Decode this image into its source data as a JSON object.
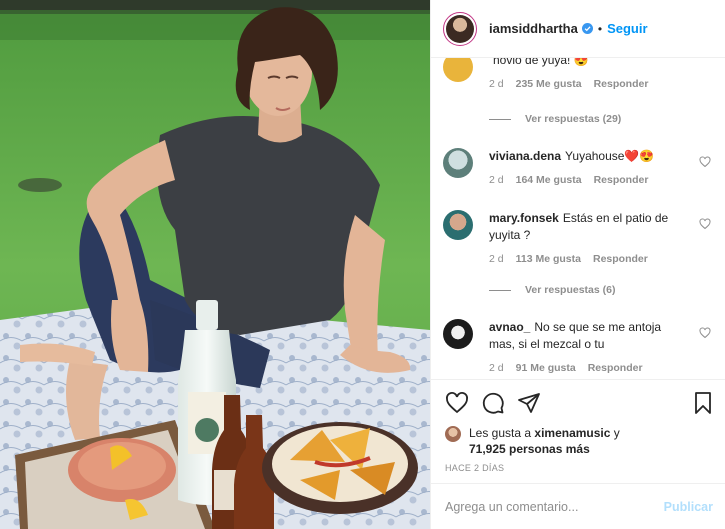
{
  "header": {
    "username": "iamsiddhartha",
    "separator": "•",
    "follow_label": "Seguir",
    "icons": {
      "verified": "verified-badge-icon",
      "avatar": "profile-avatar"
    },
    "colors": {
      "accent": "#0095f6",
      "ring": "#c13584"
    }
  },
  "comments": [
    {
      "username": "",
      "text": "novio de yuya! 😍",
      "time": "2 d",
      "likes": "235 Me gusta",
      "reply": "Responder",
      "view_replies": "Ver respuestas (29)"
    },
    {
      "username": "viviana.dena",
      "text": "Yuyahouse❤️😍",
      "time": "2 d",
      "likes": "164 Me gusta",
      "reply": "Responder",
      "view_replies": ""
    },
    {
      "username": "mary.fonsek",
      "text": "Estás en el patio de yuyita ?",
      "time": "2 d",
      "likes": "113 Me gusta",
      "reply": "Responder",
      "view_replies": "Ver respuestas (6)"
    },
    {
      "username": "avnao_",
      "text": "No se que se me antoja mas, si el mezcal o tu",
      "time": "2 d",
      "likes": "91 Me gusta",
      "reply": "Responder",
      "view_replies": ""
    }
  ],
  "actions": {
    "icons": [
      "heart-icon",
      "comment-icon",
      "share-icon",
      "bookmark-icon"
    ]
  },
  "likes": {
    "prefix": "Les gusta a",
    "user": "ximenamusic",
    "conj": "y",
    "others": "71,925 personas más"
  },
  "timestamp": "HACE 2 DÍAS",
  "add_comment": {
    "placeholder": "Agrega un comentario...",
    "publish_label": "Publicar"
  }
}
